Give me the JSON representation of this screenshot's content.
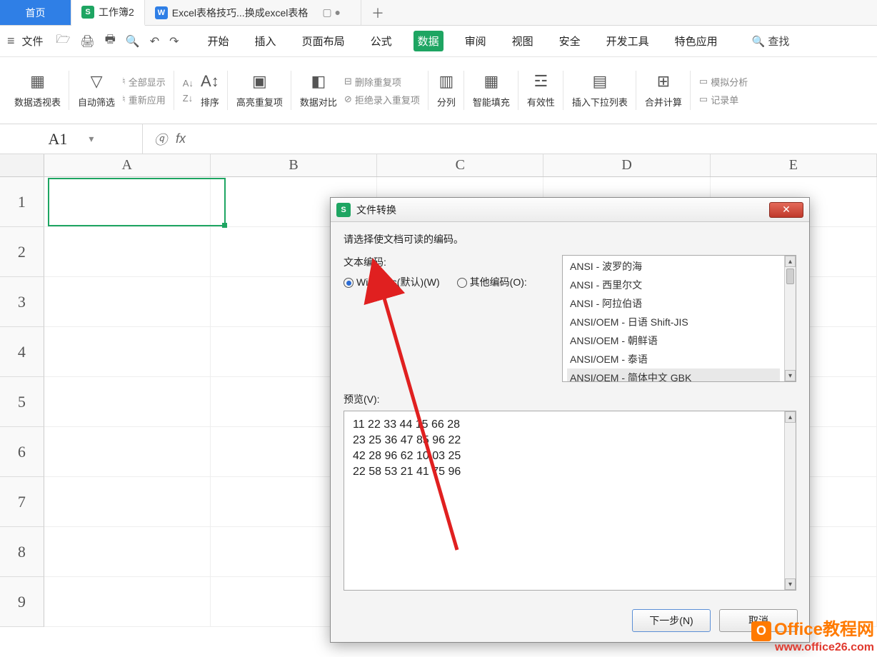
{
  "tabs": {
    "home": "首页",
    "workbook": "工作簿2",
    "second": "Excel表格技巧...换成excel表格"
  },
  "file_label": "文件",
  "menu": {
    "start": "开始",
    "insert": "插入",
    "layout": "页面布局",
    "formula": "公式",
    "data": "数据",
    "review": "审阅",
    "view": "视图",
    "security": "安全",
    "dev": "开发工具",
    "special": "特色应用",
    "search": "查找"
  },
  "ribbon": {
    "pivot": "数据透视表",
    "autofilter": "自动筛选",
    "showall": "全部显示",
    "reapply": "重新应用",
    "sort": "排序",
    "highlight_dup": "高亮重复项",
    "data_compare": "数据对比",
    "delete_dup": "删除重复项",
    "reject_dup": "拒绝录入重复项",
    "split": "分列",
    "smartfill": "智能填充",
    "validation": "有效性",
    "dropdown": "插入下拉列表",
    "consolidate": "合并计算",
    "sim": "模拟分析",
    "form": "记录单"
  },
  "cell_ref": "A1",
  "fx_label": "fx",
  "columns": [
    "A",
    "B",
    "C",
    "D",
    "E"
  ],
  "rows": [
    "1",
    "2",
    "3",
    "4",
    "5",
    "6",
    "7",
    "8",
    "9"
  ],
  "dialog": {
    "title": "文件转换",
    "hint": "请选择使文档可读的编码。",
    "encoding_label": "文本编码:",
    "radio_windows": "Windows(默认)(W)",
    "radio_other": "其他编码(O):",
    "encodings": [
      "ANSI - 波罗的海",
      "ANSI - 西里尔文",
      "ANSI - 阿拉伯语",
      "ANSI/OEM - 日语 Shift-JIS",
      "ANSI/OEM - 朝鲜语",
      "ANSI/OEM - 泰语",
      "ANSI/OEM - 简体中文 GBK"
    ],
    "preview_label": "预览(V):",
    "preview_lines": [
      "11 22 33 44 15 66 28",
      "23 25 36 47 85 96 22",
      "42 28 96 62 10 03 25",
      "22 58 53 21 41 75 96"
    ],
    "next": "下一步(N)",
    "cancel": "取消"
  },
  "watermark": {
    "line1": "Office教程网",
    "line2": "www.office26.com"
  }
}
